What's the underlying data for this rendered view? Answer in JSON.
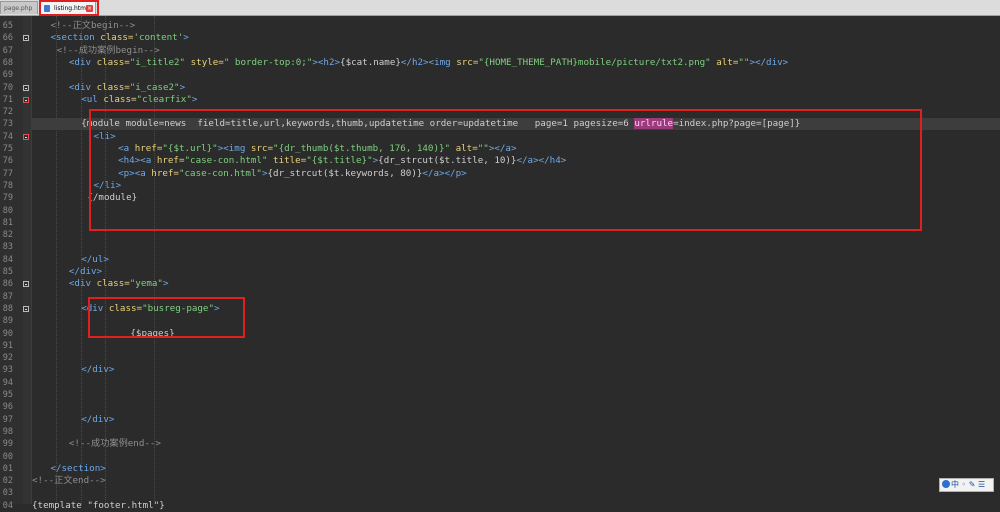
{
  "tabs": [
    {
      "label": "page.php",
      "active": false
    },
    {
      "label": "listing.html",
      "active": true
    }
  ],
  "editor": {
    "lines": [
      {
        "num": "65",
        "indent": 3,
        "tokens": [
          {
            "c": "t-cmt",
            "t": "<!--正文begin-->"
          }
        ]
      },
      {
        "num": "66",
        "indent": 3,
        "fold": true,
        "tokens": [
          {
            "c": "t-tag",
            "t": "<section "
          },
          {
            "c": "t-attr",
            "t": "class="
          },
          {
            "c": "t-str",
            "t": "'content'"
          },
          {
            "c": "t-tag",
            "t": ">"
          }
        ]
      },
      {
        "num": "67",
        "indent": 4,
        "tokens": [
          {
            "c": "t-cmt",
            "t": "<!--成功案例begin-->"
          }
        ]
      },
      {
        "num": "68",
        "indent": 6,
        "tokens": [
          {
            "c": "t-tag",
            "t": "<div "
          },
          {
            "c": "t-attr",
            "t": "class="
          },
          {
            "c": "t-str",
            "t": "\"i_title2\""
          },
          {
            "c": "t-tag",
            "t": " "
          },
          {
            "c": "t-attr",
            "t": "style="
          },
          {
            "c": "t-str",
            "t": "\" border-top:0;\""
          },
          {
            "c": "t-tag",
            "t": "><h2>"
          },
          {
            "c": "t-tmpl",
            "t": "{$cat.name}"
          },
          {
            "c": "t-tag",
            "t": "</h2><img "
          },
          {
            "c": "t-attr",
            "t": "src="
          },
          {
            "c": "t-str",
            "t": "\"{HOME_THEME_PATH}mobile/picture/txt2.png\""
          },
          {
            "c": "t-tag",
            "t": " "
          },
          {
            "c": "t-attr",
            "t": "alt="
          },
          {
            "c": "t-str",
            "t": "\"\""
          },
          {
            "c": "t-tag",
            "t": "></div>"
          }
        ]
      },
      {
        "num": "69",
        "indent": 0,
        "tokens": []
      },
      {
        "num": "70",
        "indent": 6,
        "fold": true,
        "tokens": [
          {
            "c": "t-tag",
            "t": "<div "
          },
          {
            "c": "t-attr",
            "t": "class="
          },
          {
            "c": "t-str",
            "t": "\"i_case2\""
          },
          {
            "c": "t-tag",
            "t": ">"
          }
        ]
      },
      {
        "num": "71",
        "indent": 8,
        "fold": true,
        "foldRed": true,
        "tokens": [
          {
            "c": "t-tag",
            "t": "<ul "
          },
          {
            "c": "t-attr",
            "t": "class="
          },
          {
            "c": "t-str",
            "t": "\"clearfix\""
          },
          {
            "c": "t-tag",
            "t": ">"
          }
        ]
      },
      {
        "num": "72",
        "indent": 0,
        "tokens": []
      },
      {
        "num": "73",
        "indent": 8,
        "highlight": true,
        "tokens": [
          {
            "c": "t-tmpl",
            "t": "{module module=news  field=title,url,keywords,thumb,updatetime order=updatetime   page=1 pagesize=6 "
          },
          {
            "c": "t-mark",
            "t": "urlrule"
          },
          {
            "c": "t-tmpl",
            "t": "=index.php?page=[page]}"
          }
        ]
      },
      {
        "num": "74",
        "indent": 10,
        "fold": true,
        "foldRed": true,
        "tokens": [
          {
            "c": "t-tag",
            "t": "<li>"
          }
        ]
      },
      {
        "num": "75",
        "indent": 14,
        "tokens": [
          {
            "c": "t-tag",
            "t": "<a "
          },
          {
            "c": "t-attr",
            "t": "href="
          },
          {
            "c": "t-str",
            "t": "\"{$t.url}\""
          },
          {
            "c": "t-tag",
            "t": "><img "
          },
          {
            "c": "t-attr",
            "t": "src="
          },
          {
            "c": "t-str",
            "t": "\"{dr_thumb($t.thumb, 176, 140)}\""
          },
          {
            "c": "t-tag",
            "t": " "
          },
          {
            "c": "t-attr",
            "t": "alt="
          },
          {
            "c": "t-str",
            "t": "\"\""
          },
          {
            "c": "t-tag",
            "t": "></a>"
          }
        ]
      },
      {
        "num": "76",
        "indent": 14,
        "tokens": [
          {
            "c": "t-tag",
            "t": "<h4><a "
          },
          {
            "c": "t-attr",
            "t": "href="
          },
          {
            "c": "t-str",
            "t": "\"case-con.html\""
          },
          {
            "c": "t-tag",
            "t": " "
          },
          {
            "c": "t-attr",
            "t": "title="
          },
          {
            "c": "t-str",
            "t": "\"{$t.title}\""
          },
          {
            "c": "t-tag",
            "t": ">"
          },
          {
            "c": "t-tmpl",
            "t": "{dr_strcut($t.title, 10)}"
          },
          {
            "c": "t-tag",
            "t": "</a></h4>"
          }
        ]
      },
      {
        "num": "77",
        "indent": 14,
        "tokens": [
          {
            "c": "t-tag",
            "t": "<p><a "
          },
          {
            "c": "t-attr",
            "t": "href="
          },
          {
            "c": "t-str",
            "t": "\"case-con.html\""
          },
          {
            "c": "t-tag",
            "t": ">"
          },
          {
            "c": "t-tmpl",
            "t": "{dr_strcut($t.keywords, 80)}"
          },
          {
            "c": "t-tag",
            "t": "</a></p>"
          }
        ]
      },
      {
        "num": "78",
        "indent": 10,
        "tokens": [
          {
            "c": "t-tag",
            "t": "</li>"
          }
        ]
      },
      {
        "num": "79",
        "indent": 9,
        "tokens": [
          {
            "c": "t-tmpl",
            "t": "{/module}"
          }
        ]
      },
      {
        "num": "80",
        "indent": 0,
        "tokens": []
      },
      {
        "num": "81",
        "indent": 0,
        "tokens": []
      },
      {
        "num": "82",
        "indent": 0,
        "tokens": []
      },
      {
        "num": "83",
        "indent": 0,
        "tokens": []
      },
      {
        "num": "84",
        "indent": 8,
        "tokens": [
          {
            "c": "t-tag",
            "t": "</ul>"
          }
        ]
      },
      {
        "num": "85",
        "indent": 6,
        "tokens": [
          {
            "c": "t-tag",
            "t": "</div>"
          }
        ]
      },
      {
        "num": "86",
        "indent": 6,
        "fold": true,
        "tokens": [
          {
            "c": "t-tag",
            "t": "<div "
          },
          {
            "c": "t-attr",
            "t": "class="
          },
          {
            "c": "t-str",
            "t": "\"yema\""
          },
          {
            "c": "t-tag",
            "t": ">"
          }
        ]
      },
      {
        "num": "87",
        "indent": 0,
        "tokens": []
      },
      {
        "num": "88",
        "indent": 8,
        "fold": true,
        "tokens": [
          {
            "c": "t-tag",
            "t": "<div "
          },
          {
            "c": "t-attr",
            "t": "class="
          },
          {
            "c": "t-str",
            "t": "\"busreg-page\""
          },
          {
            "c": "t-tag",
            "t": ">"
          }
        ]
      },
      {
        "num": "89",
        "indent": 0,
        "tokens": []
      },
      {
        "num": "90",
        "indent": 16,
        "tokens": [
          {
            "c": "t-tmpl",
            "t": "{$pages}"
          }
        ]
      },
      {
        "num": "91",
        "indent": 0,
        "tokens": []
      },
      {
        "num": "92",
        "indent": 0,
        "tokens": []
      },
      {
        "num": "93",
        "indent": 8,
        "tokens": [
          {
            "c": "t-tag",
            "t": "</div>"
          }
        ]
      },
      {
        "num": "94",
        "indent": 0,
        "tokens": []
      },
      {
        "num": "95",
        "indent": 0,
        "tokens": []
      },
      {
        "num": "96",
        "indent": 0,
        "tokens": []
      },
      {
        "num": "97",
        "indent": 8,
        "tokens": [
          {
            "c": "t-tag",
            "t": "</div>"
          }
        ]
      },
      {
        "num": "98",
        "indent": 0,
        "tokens": []
      },
      {
        "num": "99",
        "indent": 6,
        "tokens": [
          {
            "c": "t-cmt",
            "t": "<!--成功案例end-->"
          }
        ]
      },
      {
        "num": "00",
        "indent": 0,
        "tokens": []
      },
      {
        "num": "01",
        "indent": 3,
        "tokens": [
          {
            "c": "t-tag",
            "t": "</section>"
          }
        ]
      },
      {
        "num": "02",
        "indent": 0,
        "tokens": [
          {
            "c": "t-cmt",
            "t": "<!--正文end-->"
          }
        ]
      },
      {
        "num": "03",
        "indent": 0,
        "tokens": []
      },
      {
        "num": "04",
        "indent": 0,
        "tokens": [
          {
            "c": "t-tmpl",
            "t": "{template \"footer.html\"}"
          }
        ]
      }
    ]
  },
  "ime": {
    "label": "中"
  },
  "colors": {
    "accent_red": "#e02020",
    "editor_bg": "#2b2b2b",
    "tag": "#6fa8e6",
    "attr": "#e8d27a",
    "string": "#7fd07f"
  }
}
